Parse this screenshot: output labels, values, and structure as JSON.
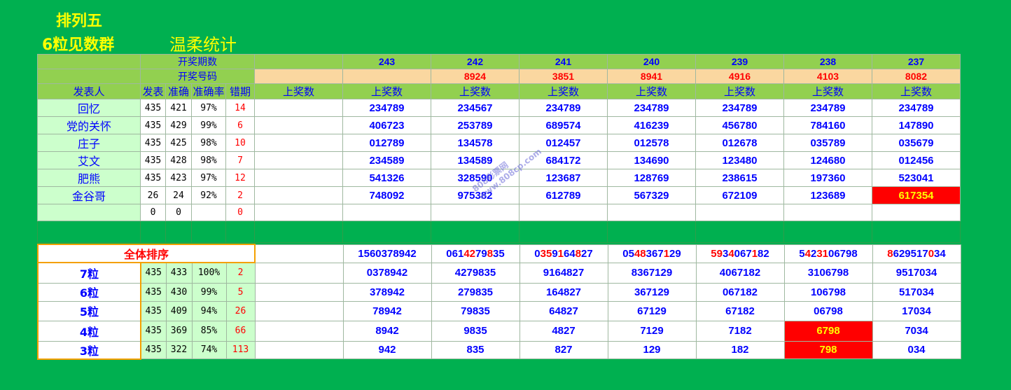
{
  "titles": {
    "line1": "排列五",
    "line2": "6粒见数群",
    "line3": "温柔统计"
  },
  "header": {
    "period_label": "开奖期数",
    "draw_label": "开奖号码",
    "publisher": "发表人",
    "published": "发表",
    "correct": "准确",
    "rate": "准确率",
    "miss": "错期",
    "prev_label": "上奖数",
    "col_label": "上奖数"
  },
  "periods": [
    {
      "id": "243",
      "draw": ""
    },
    {
      "id": "242",
      "draw": "8924"
    },
    {
      "id": "241",
      "draw": "3851"
    },
    {
      "id": "240",
      "draw": "8941"
    },
    {
      "id": "239",
      "draw": "4916"
    },
    {
      "id": "238",
      "draw": "4103"
    },
    {
      "id": "237",
      "draw": "8082"
    }
  ],
  "rows": [
    {
      "name": "回忆",
      "pub": "435",
      "ok": "421",
      "rate": "97%",
      "miss": "14",
      "values": [
        "234789",
        "234567",
        "234789",
        "234789",
        "234789",
        "234789",
        "234789"
      ]
    },
    {
      "name": "党的关怀",
      "pub": "435",
      "ok": "429",
      "rate": "99%",
      "miss": "6",
      "values": [
        "406723",
        "253789",
        "689574",
        "416239",
        "456780",
        "784160",
        "147890"
      ]
    },
    {
      "name": "庄子",
      "pub": "435",
      "ok": "425",
      "rate": "98%",
      "miss": "10",
      "values": [
        "012789",
        "134578",
        "012457",
        "012578",
        "012678",
        "035789",
        "035679"
      ]
    },
    {
      "name": "艾文",
      "pub": "435",
      "ok": "428",
      "rate": "98%",
      "miss": "7",
      "values": [
        "234589",
        "134589",
        "684172",
        "134690",
        "123480",
        "124680",
        "012456"
      ]
    },
    {
      "name": "肥熊",
      "pub": "435",
      "ok": "423",
      "rate": "97%",
      "miss": "12",
      "values": [
        "541326",
        "328590",
        "123687",
        "128769",
        "238615",
        "197360",
        "523041"
      ]
    },
    {
      "name": "金谷哥",
      "pub": "26",
      "ok": "24",
      "rate": "92%",
      "miss": "2",
      "values": [
        "748092",
        "975382",
        "612789",
        "567329",
        "672109",
        "123689",
        "617354"
      ]
    },
    {
      "name": "",
      "pub": "0",
      "ok": "0",
      "rate": "",
      "miss": "0",
      "values": [
        "",
        "",
        "",
        "",
        "",
        "",
        ""
      ]
    }
  ],
  "ranking": {
    "title": "全体排序",
    "full": [
      {
        "a": "",
        "b": "1560378942",
        "c": ""
      },
      {
        "a": "061",
        "b": "4279835",
        "c": ""
      },
      {
        "a": "03",
        "b": "591648",
        "c": "27"
      },
      {
        "a": "05",
        "b": "483671",
        "c": "29"
      },
      {
        "a": "",
        "b": "5934067182",
        "c": ""
      },
      {
        "a": "",
        "b": "5423106798",
        "c": ""
      },
      {
        "a": "",
        "b": "8629517034",
        "c": ""
      }
    ],
    "rows": [
      {
        "label": "7粒",
        "pub": "435",
        "ok": "433",
        "rate": "100%",
        "miss": "2",
        "values": [
          "0378942",
          "4279835",
          "9164827",
          "8367129",
          "4067182",
          "3106798",
          "9517034"
        ]
      },
      {
        "label": "6粒",
        "pub": "435",
        "ok": "430",
        "rate": "99%",
        "miss": "5",
        "values": [
          "378942",
          "279835",
          "164827",
          "367129",
          "067182",
          "106798",
          "517034"
        ]
      },
      {
        "label": "5粒",
        "pub": "435",
        "ok": "409",
        "rate": "94%",
        "miss": "26",
        "values": [
          "78942",
          "79835",
          "64827",
          "67129",
          "67182",
          "06798",
          "17034"
        ]
      },
      {
        "label": "4粒",
        "pub": "435",
        "ok": "369",
        "rate": "85%",
        "miss": "66",
        "values": [
          "8942",
          "9835",
          "4827",
          "7129",
          "7182",
          "6798",
          "7034"
        ]
      },
      {
        "label": "3粒",
        "pub": "435",
        "ok": "322",
        "rate": "74%",
        "miss": "113",
        "values": [
          "942",
          "835",
          "827",
          "129",
          "182",
          "798",
          "034"
        ]
      }
    ]
  },
  "watermark": {
    "line1": "808彩票网",
    "line2": "www.808cp.com"
  },
  "colors": {
    "background": "#00b050",
    "header": "#92d050",
    "draw_row": "#fad7a0",
    "hit": "#ff0000",
    "number_text": "#0000ff"
  }
}
